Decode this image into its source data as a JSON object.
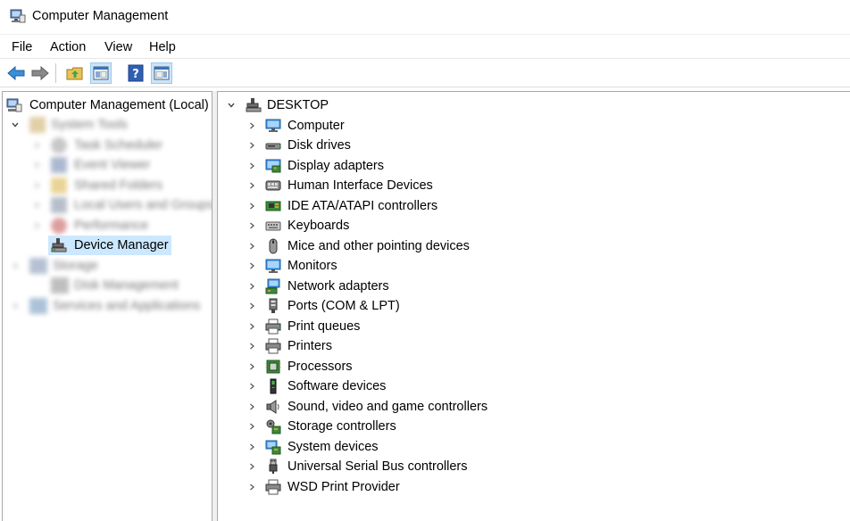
{
  "window": {
    "title": "Computer Management"
  },
  "menu": [
    "File",
    "Action",
    "View",
    "Help"
  ],
  "toolbar": [
    "back-icon",
    "forward-icon",
    "up-folder-icon",
    "show-hide-console-tree-icon",
    "help-icon",
    "show-hide-action-pane-icon"
  ],
  "tree": {
    "root": "Computer Management (Local)",
    "system_tools": "System Tools",
    "task_scheduler": "Task Scheduler",
    "event_viewer": "Event Viewer",
    "shared_folders": "Shared Folders",
    "local_users": "Local Users and Groups",
    "performance": "Performance",
    "device_manager": "Device Manager",
    "storage": "Storage",
    "disk_management": "Disk Management",
    "services": "Services and Applications"
  },
  "devices": {
    "root": "DESKTOP",
    "categories": [
      {
        "label": "Computer",
        "icon": "computer-icon"
      },
      {
        "label": "Disk drives",
        "icon": "disk-drive-icon"
      },
      {
        "label": "Display adapters",
        "icon": "display-adapter-icon"
      },
      {
        "label": "Human Interface Devices",
        "icon": "hid-icon"
      },
      {
        "label": "IDE ATA/ATAPI controllers",
        "icon": "ide-controller-icon"
      },
      {
        "label": "Keyboards",
        "icon": "keyboard-icon"
      },
      {
        "label": "Mice and other pointing devices",
        "icon": "mouse-icon"
      },
      {
        "label": "Monitors",
        "icon": "monitor-icon"
      },
      {
        "label": "Network adapters",
        "icon": "network-adapter-icon"
      },
      {
        "label": "Ports (COM & LPT)",
        "icon": "port-icon"
      },
      {
        "label": "Print queues",
        "icon": "print-queue-icon"
      },
      {
        "label": "Printers",
        "icon": "printer-icon"
      },
      {
        "label": "Processors",
        "icon": "processor-icon"
      },
      {
        "label": "Software devices",
        "icon": "software-device-icon"
      },
      {
        "label": "Sound, video and game controllers",
        "icon": "speaker-icon"
      },
      {
        "label": "Storage controllers",
        "icon": "storage-controller-icon"
      },
      {
        "label": "System devices",
        "icon": "system-device-icon"
      },
      {
        "label": "Universal Serial Bus controllers",
        "icon": "usb-icon"
      },
      {
        "label": "WSD Print Provider",
        "icon": "wsd-printer-icon"
      }
    ]
  },
  "colors": {
    "selection": "#cce8ff",
    "toolbar_pressed": "#cce4f7",
    "pane_border": "#a9a9a9"
  }
}
